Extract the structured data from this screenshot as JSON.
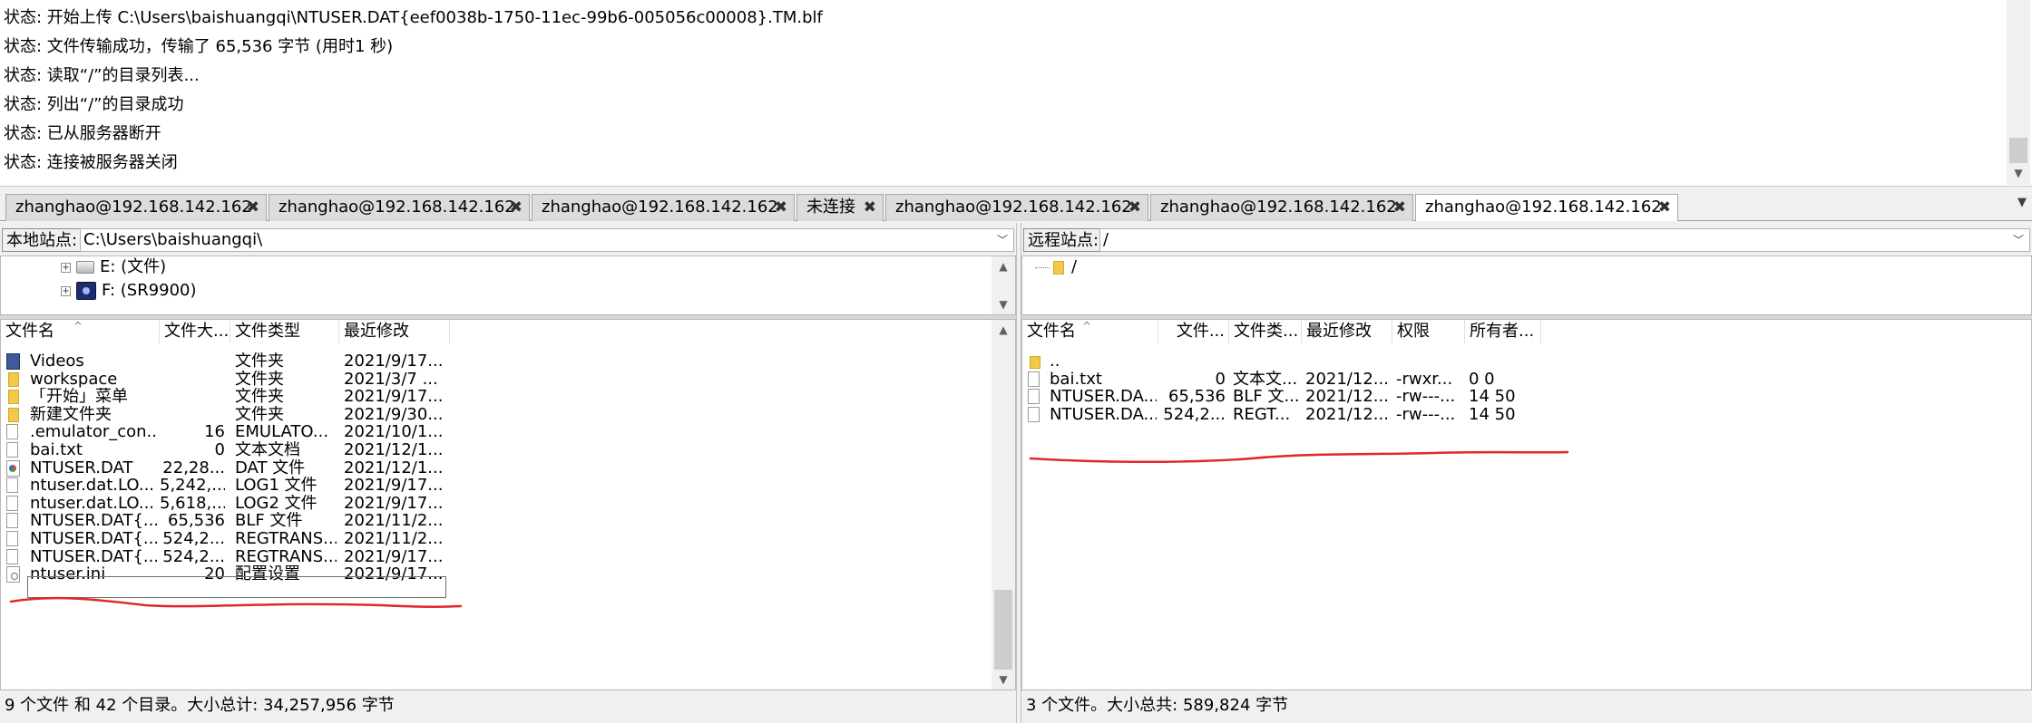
{
  "log": {
    "lines": [
      "状态: 开始上传 C:\\Users\\baishuangqi\\NTUSER.DAT{eef0038b-1750-11ec-99b6-005056c00008}.TM.blf",
      "状态: 文件传输成功，传输了 65,536 字节 (用时1 秒)",
      "状态: 读取“/”的目录列表...",
      "状态: 列出“/”的目录成功",
      "状态: 已从服务器断开",
      "状态: 连接被服务器关闭"
    ]
  },
  "tabs": [
    {
      "label": "zhanghao@192.168.142.162"
    },
    {
      "label": "zhanghao@192.168.142.162"
    },
    {
      "label": "zhanghao@192.168.142.162"
    },
    {
      "label": "未连接"
    },
    {
      "label": "zhanghao@192.168.142.162"
    },
    {
      "label": "zhanghao@192.168.142.162"
    },
    {
      "label": "zhanghao@192.168.142.162"
    }
  ],
  "tab_close_glyph": "✖",
  "local": {
    "site_label": "本地站点:",
    "path": "C:\\Users\\baishuangqi\\",
    "tree": [
      {
        "label": "E: (文件)",
        "icon": "drive-icon"
      },
      {
        "label": "F: (SR9900)",
        "icon": "network-adapter-icon"
      }
    ],
    "headers": {
      "name": "文件名",
      "size": "文件大...",
      "type": "文件类型",
      "modified": "最近修改"
    },
    "files": [
      {
        "icon": "video",
        "name": "Videos",
        "size": "",
        "type": "文件夹",
        "modified": "2021/9/17..."
      },
      {
        "icon": "folder",
        "name": "workspace",
        "size": "",
        "type": "文件夹",
        "modified": "2021/3/7 ..."
      },
      {
        "icon": "folder",
        "name": "「开始」菜单",
        "size": "",
        "type": "文件夹",
        "modified": "2021/9/17..."
      },
      {
        "icon": "folder",
        "name": "新建文件夹",
        "size": "",
        "type": "文件夹",
        "modified": "2021/9/30..."
      },
      {
        "icon": "file",
        "name": ".emulator_con...",
        "size": "16",
        "type": "EMULATO...",
        "modified": "2021/10/1..."
      },
      {
        "icon": "file",
        "name": "bai.txt",
        "size": "0",
        "type": "文本文档",
        "modified": "2021/12/1..."
      },
      {
        "icon": "dat",
        "name": "NTUSER.DAT",
        "size": "22,28...",
        "type": "DAT 文件",
        "modified": "2021/12/1..."
      },
      {
        "icon": "file",
        "name": "ntuser.dat.LO...",
        "size": "5,242,...",
        "type": "LOG1 文件",
        "modified": "2021/9/17..."
      },
      {
        "icon": "file",
        "name": "ntuser.dat.LO...",
        "size": "5,618,...",
        "type": "LOG2 文件",
        "modified": "2021/9/17..."
      },
      {
        "icon": "file",
        "name": "NTUSER.DAT{...",
        "size": "65,536",
        "type": "BLF 文件",
        "modified": "2021/11/2..."
      },
      {
        "icon": "file",
        "name": "NTUSER.DAT{...",
        "size": "524,2...",
        "type": "REGTRANS...",
        "modified": "2021/11/2..."
      },
      {
        "icon": "file",
        "name": "NTUSER.DAT{...",
        "size": "524,2...",
        "type": "REGTRANS...",
        "modified": "2021/9/17..."
      },
      {
        "icon": "ini",
        "name": "ntuser.ini",
        "size": "20",
        "type": "配置设置",
        "modified": "2021/9/17..."
      }
    ],
    "status": "9 个文件 和 42 个目录。大小总计: 34,257,956 字节"
  },
  "remote": {
    "site_label": "远程站点:",
    "path": "/",
    "tree": [
      {
        "label": "/"
      }
    ],
    "headers": {
      "name": "文件名",
      "size": "文件...",
      "type": "文件类...",
      "modified": "最近修改",
      "perms": "权限",
      "owner": "所有者..."
    },
    "files": [
      {
        "icon": "up",
        "name": "..",
        "size": "",
        "type": "",
        "modified": "",
        "perms": "",
        "owner": ""
      },
      {
        "icon": "file",
        "name": "bai.txt",
        "size": "0",
        "type": "文本文...",
        "modified": "2021/12...",
        "perms": "-rwxr...",
        "owner": "0 0"
      },
      {
        "icon": "file",
        "name": "NTUSER.DA...",
        "size": "65,536",
        "type": "BLF 文...",
        "modified": "2021/12...",
        "perms": "-rw---...",
        "owner": "14 50"
      },
      {
        "icon": "file",
        "name": "NTUSER.DA...",
        "size": "524,2...",
        "type": "REGT...",
        "modified": "2021/12...",
        "perms": "-rw---...",
        "owner": "14 50"
      }
    ],
    "status": "3 个文件。大小总共: 589,824 字节"
  },
  "accent_colors": {
    "annotation_red": "#e0282c",
    "folder_yellow": "#f2c94c"
  }
}
